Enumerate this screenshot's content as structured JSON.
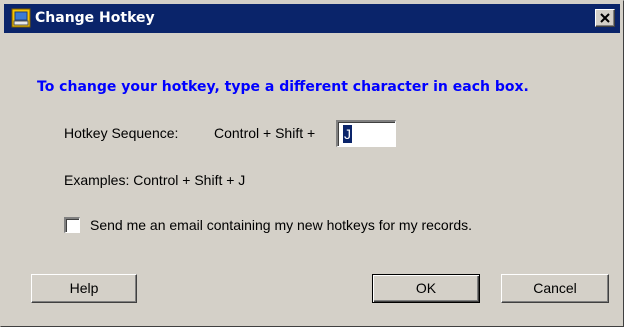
{
  "window": {
    "title": "Change Hotkey",
    "title_icon": "app-icon",
    "close_label": "close-icon"
  },
  "content": {
    "instruction": "To change your hotkey, type a different character in each box.",
    "sequence_label": "Hotkey Sequence:",
    "sequence_prefix": "Control + Shift +",
    "hotkey_value": "J",
    "examples": "Examples: Control + Shift + J",
    "email_checkbox_label": "Send me an email containing my new hotkeys for my records.",
    "email_checkbox_checked": false
  },
  "buttons": {
    "help": "Help",
    "ok": "OK",
    "cancel": "Cancel"
  },
  "colors": {
    "titlebar": "#0a246a",
    "instruction": "#0000ff",
    "face": "#d4d0c8"
  }
}
